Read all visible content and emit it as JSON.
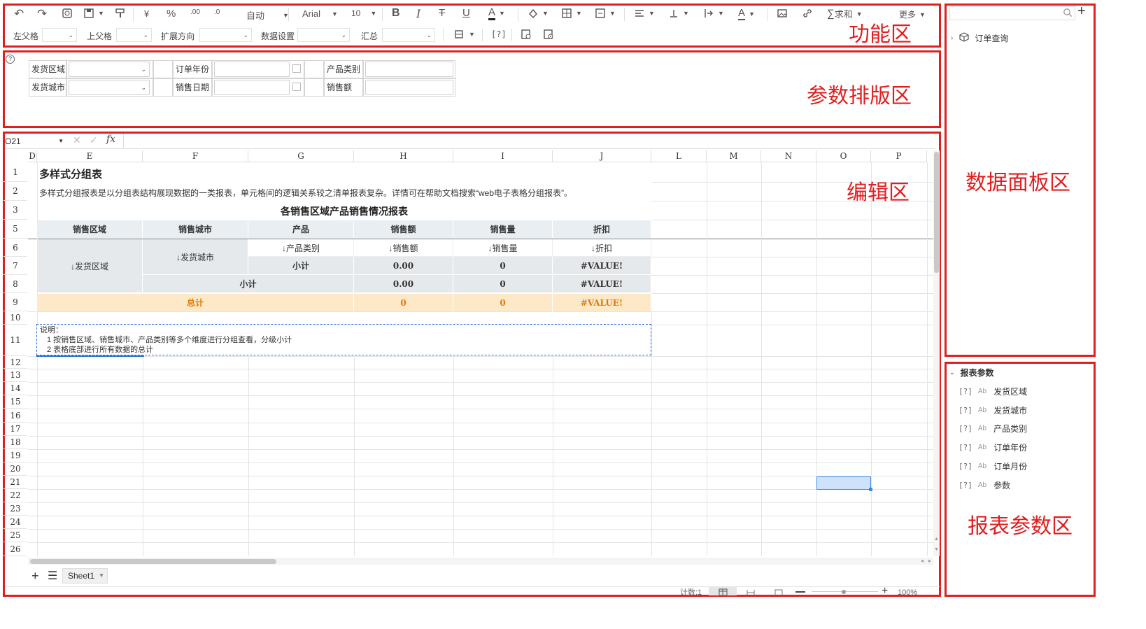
{
  "toolbar": {
    "row1": {
      "auto_label": "自动",
      "font_name": "Arial",
      "font_size": "10",
      "sum_label": "求和",
      "more_label": "更多"
    },
    "row2": {
      "left_parent": "左父格",
      "up_parent": "上父格",
      "expand_dir": "扩展方向",
      "data_setting": "数据设置",
      "summary": "汇总",
      "param_glyph": "[?]"
    }
  },
  "zones": {
    "function": "功能区",
    "param_layout": "参数排版区",
    "edit": "编辑区",
    "data_panel": "数据面板区",
    "report_params": "报表参数区"
  },
  "params": {
    "help_glyph": "?",
    "row1": {
      "a": "发货区域",
      "b": "订单年份",
      "c": "产品类别"
    },
    "row2": {
      "a": "发货城市",
      "b": "销售日期",
      "c": "销售额"
    }
  },
  "formula_bar": {
    "cell_ref": "O21",
    "fx": "fx"
  },
  "columns": [
    "D",
    "E",
    "F",
    "G",
    "H",
    "I",
    "J",
    "L",
    "M",
    "N",
    "O",
    "P"
  ],
  "rows": [
    "1",
    "2",
    "3",
    "5",
    "6",
    "7",
    "8",
    "9",
    "10",
    "11",
    "12",
    "13",
    "14",
    "15",
    "16",
    "17",
    "18",
    "19",
    "20",
    "21",
    "22",
    "23",
    "24",
    "25",
    "26"
  ],
  "sheet": {
    "title": "多样式分组表",
    "description": "多样式分组报表是以分组表结构展现数据的一类报表，单元格间的逻辑关系较之清单报表复杂。详情可在帮助文档搜索“web电子表格分组报表”。",
    "report_title": "各销售区域产品销售情况报表",
    "headers": [
      "销售区域",
      "销售城市",
      "产品",
      "销售额",
      "销售量",
      "折扣"
    ],
    "r6": {
      "region": "↓发货区域",
      "city": "↓发货城市",
      "product": "↓产品类别",
      "amount": "↓销售额",
      "qty": "↓销售量",
      "discount": "↓折扣"
    },
    "r7": {
      "label": "小计",
      "amount": "0.00",
      "qty": "0",
      "discount": "#VALUE!"
    },
    "r8": {
      "label": "小计",
      "amount": "0.00",
      "qty": "0",
      "discount": "#VALUE!"
    },
    "r9": {
      "label": "总计",
      "amount": "0",
      "qty": "0",
      "discount": "#VALUE!"
    },
    "note_title": "说明：",
    "note_1": "1  按销售区域、销售城市、产品类别等多个维度进行分组查看，分级小计",
    "note_2": "2  表格底部进行所有数据的总计"
  },
  "bottom": {
    "sheet_tab": "Sheet1",
    "count": "计数:1",
    "zoom": "100%"
  },
  "right_panel": {
    "datasource": "订单查询",
    "params_header": "报表参数",
    "params": [
      "发货区域",
      "发货城市",
      "产品类别",
      "订单年份",
      "订单月份",
      "参数"
    ]
  }
}
